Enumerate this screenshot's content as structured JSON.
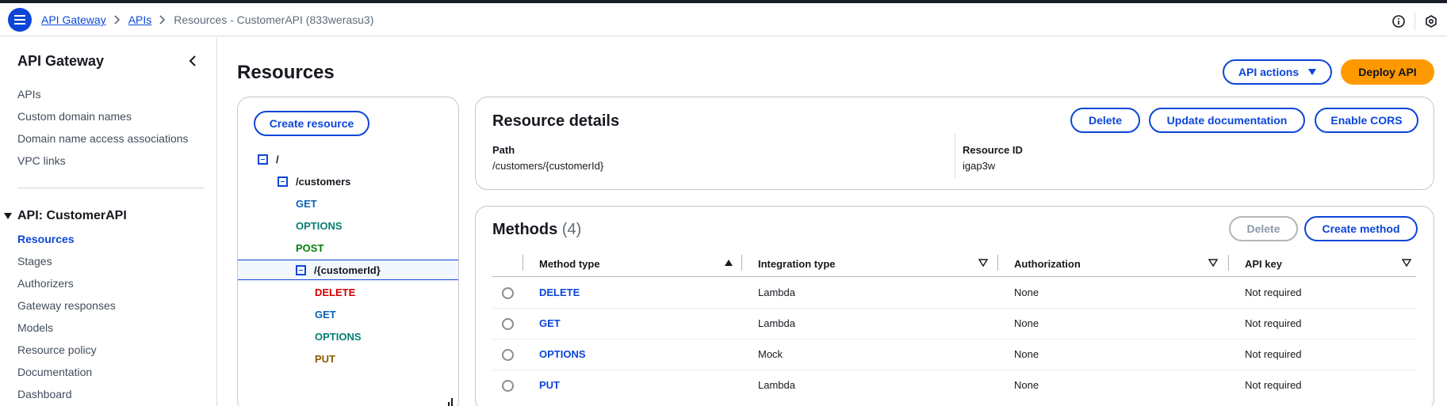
{
  "header": {
    "breadcrumbs": [
      "API Gateway",
      "APIs"
    ],
    "current": "Resources - CustomerAPI (833werasu3)"
  },
  "sidebar": {
    "title": "API Gateway",
    "links": [
      "APIs",
      "Custom domain names",
      "Domain name access associations",
      "VPC links"
    ],
    "section_title": "API: CustomerAPI",
    "section_items": [
      "Resources",
      "Stages",
      "Authorizers",
      "Gateway responses",
      "Models",
      "Resource policy",
      "Documentation",
      "Dashboard"
    ],
    "active_item": "Resources"
  },
  "page": {
    "title": "Resources",
    "api_actions_label": "API actions",
    "deploy_label": "Deploy API"
  },
  "tree": {
    "create_label": "Create resource",
    "root": "/",
    "customers": "/customers",
    "customers_methods": [
      "GET",
      "OPTIONS",
      "POST"
    ],
    "customer_id": "/{customerId}",
    "customer_id_methods": [
      "DELETE",
      "GET",
      "OPTIONS",
      "PUT"
    ]
  },
  "resource_details": {
    "title": "Resource details",
    "buttons": [
      "Delete",
      "Update documentation",
      "Enable CORS"
    ],
    "path_label": "Path",
    "path_value": "/customers/{customerId}",
    "id_label": "Resource ID",
    "id_value": "igap3w"
  },
  "methods": {
    "title": "Methods",
    "count": "(4)",
    "delete_label": "Delete",
    "create_label": "Create method",
    "columns": [
      "Method type",
      "Integration type",
      "Authorization",
      "API key"
    ],
    "rows": [
      {
        "method": "DELETE",
        "integration": "Lambda",
        "authorization": "None",
        "api_key": "Not required"
      },
      {
        "method": "GET",
        "integration": "Lambda",
        "authorization": "None",
        "api_key": "Not required"
      },
      {
        "method": "OPTIONS",
        "integration": "Mock",
        "authorization": "None",
        "api_key": "Not required"
      },
      {
        "method": "PUT",
        "integration": "Lambda",
        "authorization": "None",
        "api_key": "Not required"
      }
    ]
  },
  "colors": {
    "accent": "#0b46d9",
    "deploy": "#ff9900",
    "method_get": "#0b63b6",
    "method_options": "#037f73",
    "method_post": "#037f0c",
    "method_delete": "#d10000",
    "method_put": "#8a5a00"
  },
  "icons": [
    "menu-icon",
    "chevron-right-icon",
    "info-icon",
    "settings-hexagon-icon",
    "chevron-left-icon",
    "caret-down-icon",
    "collapse-box-icon",
    "sort-ascending-icon",
    "sort-descending-icon",
    "resize-handle-icon"
  ]
}
